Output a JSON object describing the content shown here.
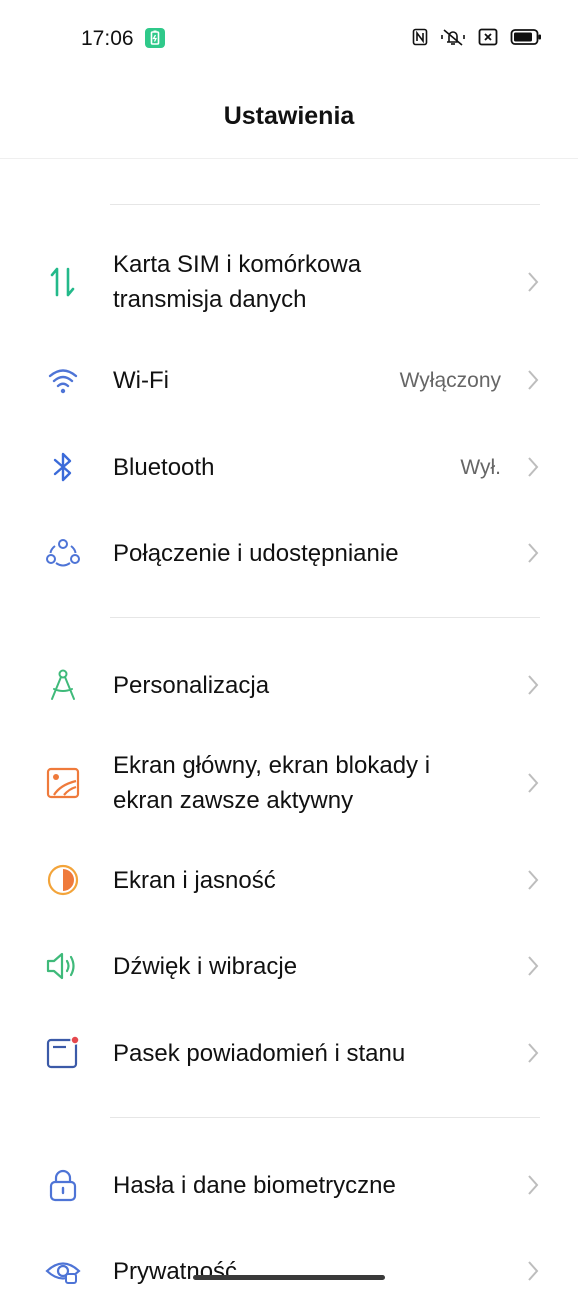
{
  "status_bar": {
    "time": "17:06",
    "icons": [
      "battery-charging-icon",
      "nfc-icon",
      "mute-vibrate-icon",
      "no-sim-icon",
      "battery-icon"
    ]
  },
  "header": {
    "title": "Ustawienia"
  },
  "colors": {
    "accent_green": "#2fc98a",
    "icon_blue": "#3b6bd9",
    "icon_orange": "#ef7a3b",
    "icon_yellow": "#f3a43a",
    "icon_green": "#3fba7a"
  },
  "settings": {
    "sim": {
      "label_line1": "Karta SIM i komórkowa",
      "label_line2": "transmisja danych"
    },
    "wifi": {
      "label": "Wi-Fi",
      "value": "Wyłączony"
    },
    "bluetooth": {
      "label": "Bluetooth",
      "value": "Wył."
    },
    "connection": {
      "label": "Połączenie i udostępnianie"
    },
    "personalization": {
      "label": "Personalizacja"
    },
    "home_screen": {
      "label_line1": "Ekran główny, ekran blokady i",
      "label_line2": "ekran zawsze aktywny"
    },
    "display": {
      "label": "Ekran i jasność"
    },
    "sound": {
      "label": "Dźwięk i wibracje"
    },
    "notifications": {
      "label": "Pasek powiadomień i stanu"
    },
    "passwords": {
      "label": "Hasła i dane biometryczne"
    },
    "privacy": {
      "label": "Prywatność"
    }
  }
}
